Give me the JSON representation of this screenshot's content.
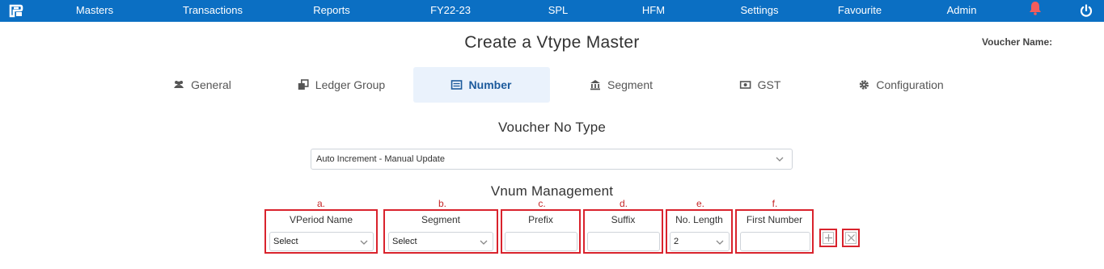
{
  "nav": {
    "items": [
      "Masters",
      "Transactions",
      "Reports",
      "FY22-23",
      "SPL",
      "HFM",
      "Settings",
      "Favourite",
      "Admin"
    ],
    "colors": {
      "bar": "#0b6fc3",
      "bell": "#f25c5c"
    }
  },
  "header": {
    "title": "Create a Vtype Master",
    "voucher_name_label": "Voucher Name:"
  },
  "tabs": [
    {
      "label": "General",
      "icon": "users-icon"
    },
    {
      "label": "Ledger Group",
      "icon": "clone-icon"
    },
    {
      "label": "Number",
      "icon": "list-icon",
      "active": true
    },
    {
      "label": "Segment",
      "icon": "bank-icon"
    },
    {
      "label": "GST",
      "icon": "money-icon"
    },
    {
      "label": "Configuration",
      "icon": "gear-icon"
    }
  ],
  "voucher_no_type": {
    "title": "Voucher No Type",
    "selected": "Auto Increment - Manual Update"
  },
  "vnum": {
    "title": "Vnum Management",
    "fields": [
      {
        "letter": "a.",
        "label": "VPeriod Name",
        "value": "Select"
      },
      {
        "letter": "b.",
        "label": "Segment",
        "value": "Select"
      },
      {
        "letter": "c.",
        "label": "Prefix",
        "value": ""
      },
      {
        "letter": "d.",
        "label": "Suffix",
        "value": ""
      },
      {
        "letter": "e.",
        "label": "No. Length",
        "value": "2"
      },
      {
        "letter": "f.",
        "label": "First Number",
        "value": ""
      }
    ],
    "annotation_color": "#d9232d"
  }
}
